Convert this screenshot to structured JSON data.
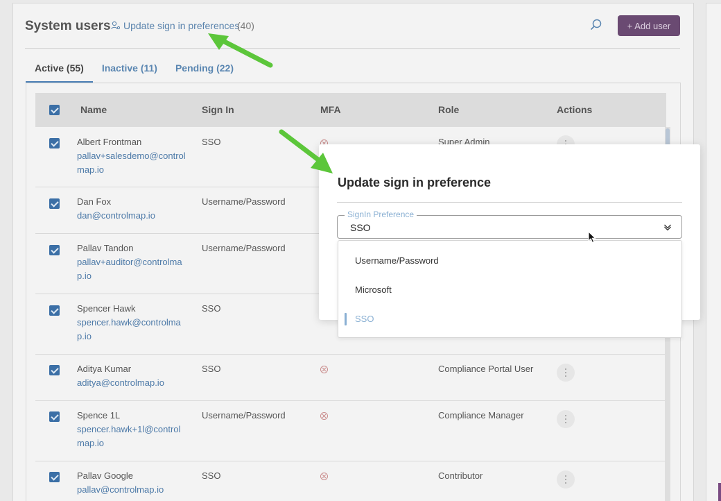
{
  "header": {
    "title": "System users",
    "pref_link": "Update sign in preferences",
    "pref_count": "(40)",
    "add_button": "+ Add user"
  },
  "tabs": [
    {
      "label": "Active (55)",
      "active": true
    },
    {
      "label": "Inactive (11)",
      "active": false
    },
    {
      "label": "Pending (22)",
      "active": false
    }
  ],
  "table": {
    "columns": [
      "Name",
      "Sign In",
      "MFA",
      "Role",
      "Actions"
    ],
    "rows": [
      {
        "name": "Albert Frontman",
        "email": "pallav+salesdemo@controlmap.io",
        "sign_in": "SSO",
        "role": "Super Admin"
      },
      {
        "name": "Dan Fox",
        "email": "dan@controlmap.io",
        "sign_in": "Username/Password",
        "role": ""
      },
      {
        "name": "Pallav Tandon",
        "email": "pallav+auditor@controlmap.io",
        "sign_in": "Username/Password",
        "role": ""
      },
      {
        "name": "Spencer Hawk",
        "email": "spencer.hawk@controlmap.io",
        "sign_in": "SSO",
        "role": ""
      },
      {
        "name": "Aditya Kumar",
        "email": "aditya@controlmap.io",
        "sign_in": "SSO",
        "role": "Compliance Portal User"
      },
      {
        "name": "Spence 1L",
        "email": "spencer.hawk+1l@controlmap.io",
        "sign_in": "Username/Password",
        "role": "Compliance Manager"
      },
      {
        "name": "Pallav Google",
        "email": "pallav@controlmap.io",
        "sign_in": "SSO",
        "role": "Contributor"
      }
    ]
  },
  "modal": {
    "title": "Update sign in preference",
    "field_label": "SignIn Preference",
    "field_value": "SSO",
    "options": [
      "Username/Password",
      "Microsoft",
      "SSO"
    ],
    "selected_option": "SSO"
  },
  "colors": {
    "accent": "#4a7fb5",
    "link": "#4d7aa8",
    "add_button": "#6a4a72",
    "arrow": "#5cc63a",
    "mfa_off": "#c98b8b"
  }
}
